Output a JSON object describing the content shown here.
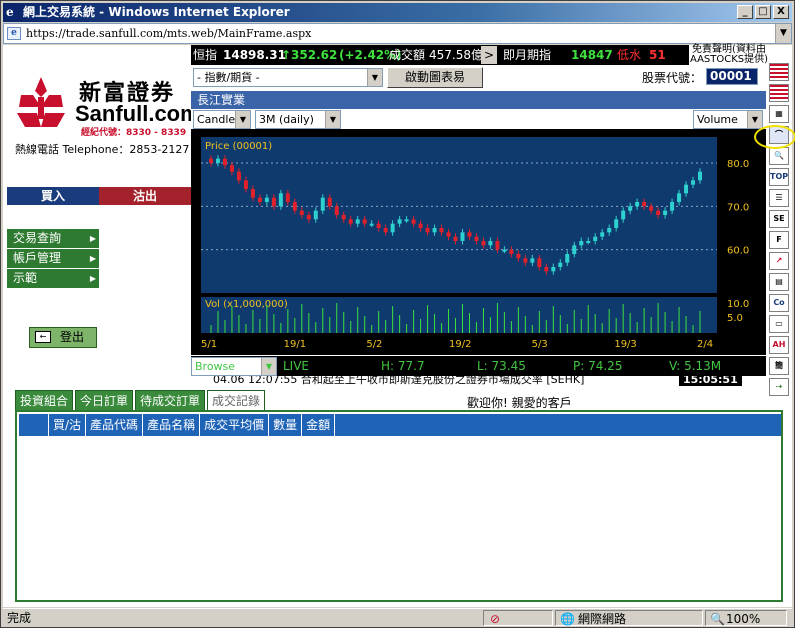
{
  "window": {
    "title": "網上交易系統 - Windows Internet Explorer",
    "url": "https://trade.sanfull.com/mts.web/MainFrame.aspx",
    "min": "_",
    "max": "□",
    "close": "X"
  },
  "brand": {
    "cn": "新富證券",
    "en": "Sanfull.com",
    "dealer": "經紀代號：8330 - 8339",
    "hotline": "熱線電話 Telephone：2853-2127"
  },
  "actions": {
    "buy": "買入",
    "sell": "沽出",
    "logout": "登出"
  },
  "menu": [
    {
      "label": "交易查詢"
    },
    {
      "label": "帳戶管理"
    },
    {
      "label": "示範"
    }
  ],
  "ticker": {
    "index_label": "恒指",
    "index_value": "14898.31",
    "change": "↑352.62",
    "pct": "(+2.42%)",
    "turnover_label": "成交額",
    "turnover": "457.58億",
    "futures_label": "即月期指",
    "futures": "14847",
    "discount_label": "低水",
    "discount": "51",
    "disclaimer": "免責聲明(資料由AASTOCKS提供)"
  },
  "controls": {
    "index_select": "- 指數/期貨 -",
    "chart_button": "啟動圖表易",
    "stock_code_label": "股票代號：",
    "stock_code": "00001"
  },
  "stock": {
    "name": "長江實業"
  },
  "chart_controls": {
    "type": "Candle",
    "period": "3M (daily)",
    "indicator": "Volume"
  },
  "chart_data": {
    "type": "candlestick",
    "price_label": "Price (00001)",
    "vol_label": "Vol (x1,000,000)",
    "y_ticks": [
      "80.0",
      "70.0",
      "60.0"
    ],
    "vol_ticks": [
      "10.0",
      "5.0"
    ],
    "x_ticks": [
      "5/1",
      "19/1",
      "5/2",
      "19/2",
      "5/3",
      "19/3",
      "2/4"
    ],
    "up_color": "#2fd0d0",
    "down_color": "#e0202a",
    "closes": [
      80,
      81,
      79.5,
      78,
      76,
      74,
      72,
      71,
      72,
      70,
      73,
      71,
      69,
      68,
      67,
      69,
      72,
      70,
      68,
      67,
      66,
      67,
      66,
      66,
      65,
      64,
      66,
      67,
      67,
      66,
      65,
      64,
      65,
      64,
      63,
      62,
      64,
      63,
      62,
      61,
      62,
      60,
      60,
      59,
      58,
      57,
      58,
      56,
      55,
      56,
      57,
      59,
      61,
      62,
      62,
      63,
      64,
      65,
      67,
      69,
      70,
      71,
      70,
      69,
      68,
      69,
      71,
      73,
      75,
      76,
      78
    ]
  },
  "quote": {
    "mode": "Browse",
    "live": "LIVE",
    "high": "H: 77.7",
    "low": "L: 73.45",
    "price": "P: 74.25",
    "volume": "V: 5.13M"
  },
  "news": {
    "text": "04.06 12:07:55  合和起至上午收市即斯達克股份之證券市場成交率 [SEHK]",
    "time": "15:05:51"
  },
  "tabs": [
    {
      "label": "投資組合"
    },
    {
      "label": "今日訂單"
    },
    {
      "label": "待成交訂單"
    },
    {
      "label": "成交記錄"
    }
  ],
  "welcome": "歡迎你! 親愛的客戶",
  "table": {
    "columns": [
      "",
      "買/沽",
      "產品代碼",
      "產品名稱",
      "成交平均價",
      "數量",
      "金額"
    ]
  },
  "status": {
    "text": "完成",
    "zone": "網際網路",
    "zoom": "100%"
  }
}
